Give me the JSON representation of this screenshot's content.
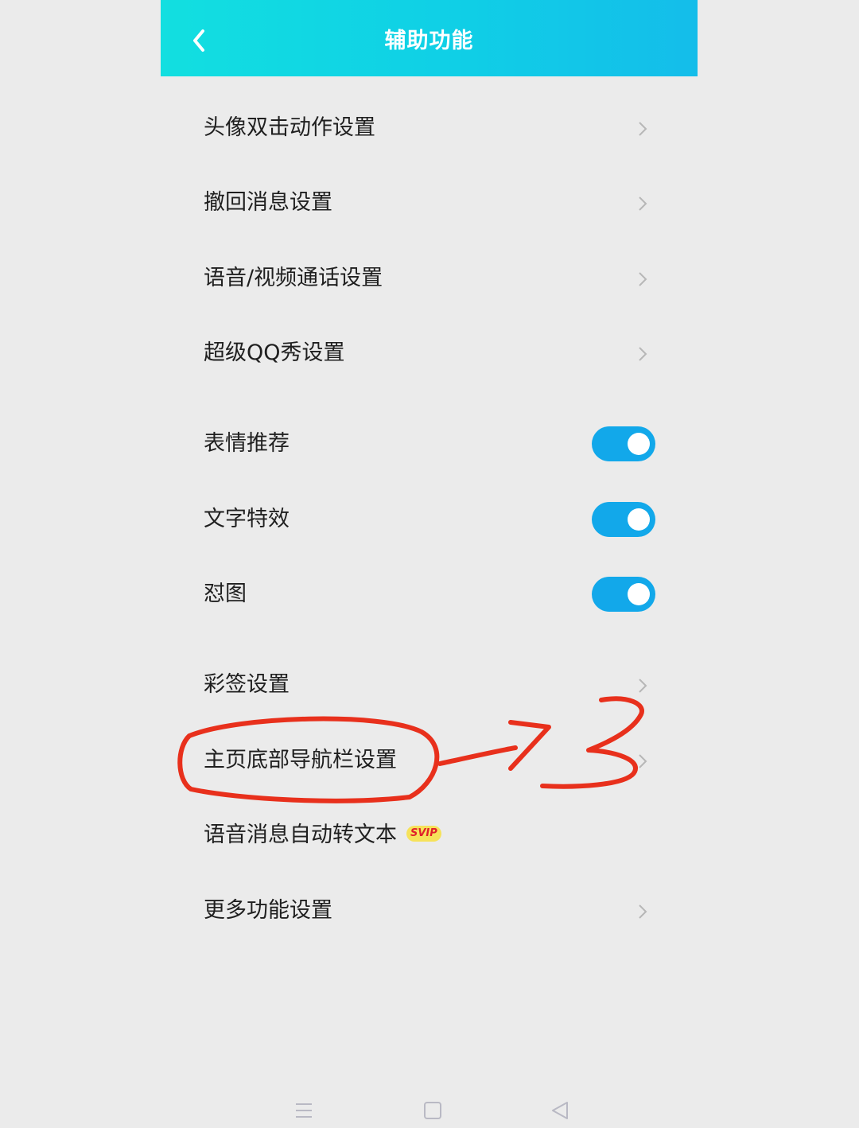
{
  "header": {
    "title": "辅助功能"
  },
  "items": [
    {
      "label": "头像双击动作设置",
      "control": "chevron"
    },
    {
      "label": "撤回消息设置",
      "control": "chevron"
    },
    {
      "label": "语音/视频通话设置",
      "control": "chevron"
    },
    {
      "label": "超级QQ秀设置",
      "control": "chevron"
    },
    {
      "label": "表情推荐",
      "control": "toggle",
      "on": true
    },
    {
      "label": "文字特效",
      "control": "toggle",
      "on": true
    },
    {
      "label": "怼图",
      "control": "toggle",
      "on": true
    },
    {
      "label": "彩签设置",
      "control": "chevron"
    },
    {
      "label": "主页底部导航栏设置",
      "control": "chevron"
    },
    {
      "label": "语音消息自动转文本",
      "control": "badge",
      "badge": "SVIP"
    },
    {
      "label": "更多功能设置",
      "control": "chevron"
    }
  ],
  "colors": {
    "accent": "#12a8ea",
    "header_start": "#12dfe0",
    "header_end": "#14bdea",
    "annotation": "#e8301c"
  },
  "nav": {
    "icons": [
      "menu-icon",
      "home-square-icon",
      "back-triangle-icon"
    ]
  }
}
